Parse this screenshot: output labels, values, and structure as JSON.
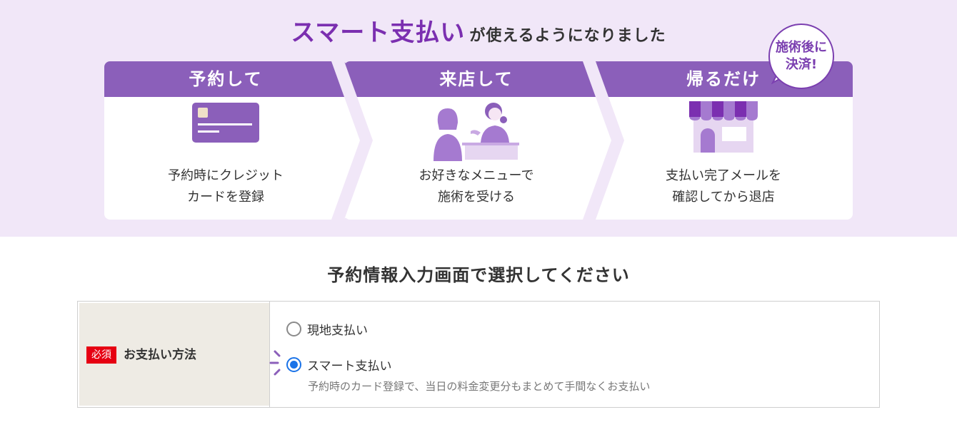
{
  "banner": {
    "headline_accent": "スマート支払い",
    "headline_rest": "が使えるようになりました",
    "badge_line1": "施術後に",
    "badge_line2": "決済!",
    "steps": [
      {
        "title": "予約して",
        "line1": "予約時にクレジット",
        "line2": "カードを登録",
        "icon": "credit-card-icon"
      },
      {
        "title": "来店して",
        "line1": "お好きなメニューで",
        "line2": "施術を受ける",
        "icon": "salon-visit-icon"
      },
      {
        "title": "帰るだけ",
        "line1": "支払い完了メールを",
        "line2": "確認してから退店",
        "icon": "storefront-icon"
      }
    ],
    "colors": {
      "background": "#f1e7f8",
      "header": "#8b5fba",
      "accent": "#7b2fb0"
    }
  },
  "form": {
    "title": "予約情報入力画面で選択してください",
    "required_badge": "必須",
    "label": "お支払い方法",
    "options": [
      {
        "label": "現地支払い",
        "selected": false
      },
      {
        "label": "スマート支払い",
        "selected": true
      }
    ],
    "smart_description": "予約時のカード登録で、当日の料金変更分もまとめて手間なくお支払い",
    "colors": {
      "required": "#e60012",
      "radio": "#1a73e8"
    }
  }
}
